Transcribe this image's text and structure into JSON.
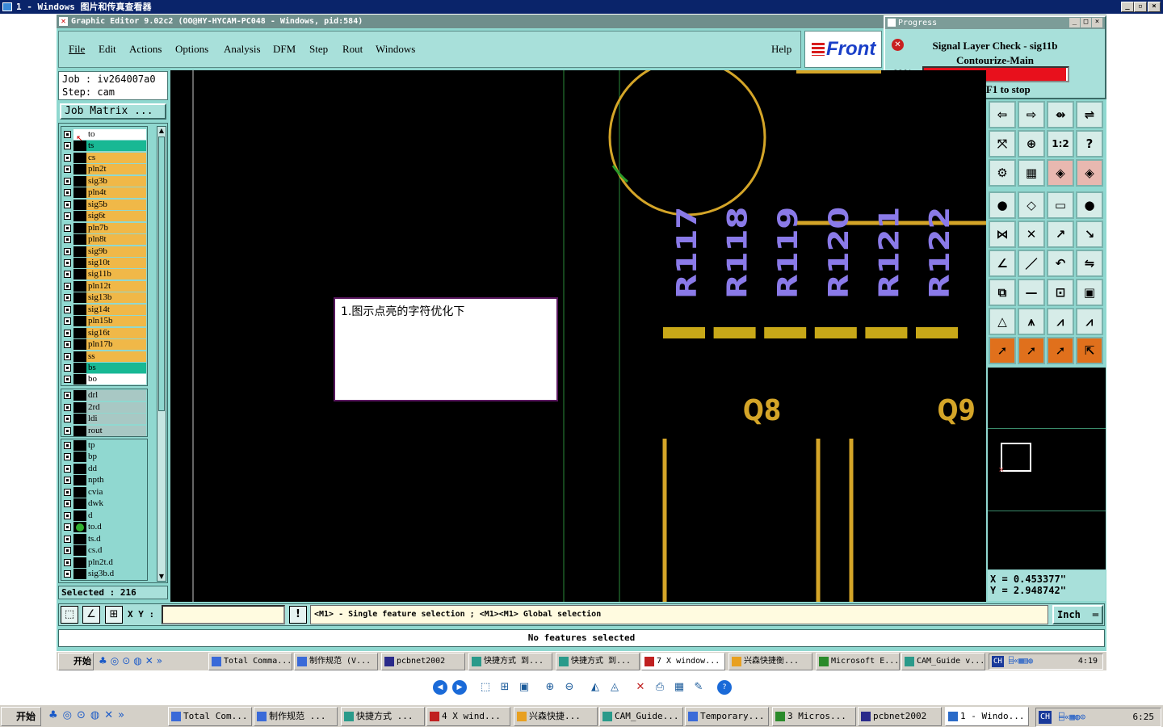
{
  "outer_window": {
    "title": "1 - Windows 图片和传真查看器"
  },
  "editor": {
    "title": "Graphic Editor 9.02c2 (OO@HY-HYCAM-PC048 - Windows, pid:584)",
    "menus": [
      "File",
      "Edit",
      "Actions",
      "Options",
      "Analysis",
      "DFM",
      "Step",
      "Rout",
      "Windows"
    ],
    "help": "Help",
    "logo": "Front"
  },
  "progress": {
    "title": "Progress",
    "line1": "Signal Layer Check - sig11b",
    "line2": "Contourize-Main",
    "percent_label": "99%",
    "percent": 0.99,
    "stop_hint": "Press F1 to stop",
    "bar_color": "#e8101c"
  },
  "job": {
    "job_line": "Job : iv264007a0",
    "step_line": "Step: cam",
    "matrix_button": "Job Matrix ..."
  },
  "layers": [
    {
      "name": "to",
      "color": "#ffffff",
      "mark": "▪"
    },
    {
      "name": "ts",
      "color": "#18b894",
      "mark": ""
    },
    {
      "name": "cs",
      "color": "#f0b848",
      "mark": "◢"
    },
    {
      "name": "pln2t",
      "color": "#f0b848",
      "mark": ""
    },
    {
      "name": "sig3b",
      "color": "#f0b848",
      "mark": ""
    },
    {
      "name": "pln4t",
      "color": "#f0b848",
      "mark": ""
    },
    {
      "name": "sig5b",
      "color": "#f0b848",
      "mark": ""
    },
    {
      "name": "sig6t",
      "color": "#f0b848",
      "mark": ""
    },
    {
      "name": "pln7b",
      "color": "#f0b848",
      "mark": ""
    },
    {
      "name": "pln8t",
      "color": "#f0b848",
      "mark": ""
    },
    {
      "name": "sig9b",
      "color": "#f0b848",
      "mark": ""
    },
    {
      "name": "sig10t",
      "color": "#f0b848",
      "mark": ""
    },
    {
      "name": "sig11b",
      "color": "#f0b848",
      "mark": ""
    },
    {
      "name": "pln12t",
      "color": "#f0b848",
      "mark": ""
    },
    {
      "name": "sig13b",
      "color": "#f0b848",
      "mark": ""
    },
    {
      "name": "sig14t",
      "color": "#f0b848",
      "mark": ""
    },
    {
      "name": "pln15b",
      "color": "#f0b848",
      "mark": ""
    },
    {
      "name": "sig16t",
      "color": "#f0b848",
      "mark": ""
    },
    {
      "name": "pln17b",
      "color": "#f0b848",
      "mark": ""
    },
    {
      "name": "ss",
      "color": "#f0b848",
      "mark": "◢"
    },
    {
      "name": "bs",
      "color": "#18b894",
      "mark": ""
    },
    {
      "name": "bo",
      "color": "#ffffff",
      "mark": ""
    }
  ],
  "layers_drill": [
    {
      "name": "drl",
      "color": "#a8c8c4"
    },
    {
      "name": "2rd",
      "color": "#a8c8c4"
    },
    {
      "name": "ldi",
      "color": "#a8c8c4"
    },
    {
      "name": "rout",
      "color": "#a8c8c4"
    }
  ],
  "layers_misc": [
    {
      "name": "tp",
      "color": "#90d8d0",
      "mark": ""
    },
    {
      "name": "bp",
      "color": "#90d8d0",
      "mark": ""
    },
    {
      "name": "dd",
      "color": "#90d8d0",
      "mark": ""
    },
    {
      "name": "npth",
      "color": "#90d8d0",
      "mark": ""
    },
    {
      "name": "cvia",
      "color": "#90d8d0",
      "mark": ""
    },
    {
      "name": "dwk",
      "color": "#90d8d0",
      "mark": ""
    },
    {
      "name": "d",
      "color": "#90d8d0",
      "mark": ""
    },
    {
      "name": "to.d",
      "color": "#90d8d0",
      "mark": ""
    },
    {
      "name": "ts.d",
      "color": "#90d8d0",
      "mark": ""
    },
    {
      "name": "cs.d",
      "color": "#90d8d0",
      "mark": "◢"
    },
    {
      "name": "pln2t.d",
      "color": "#90d8d0",
      "mark": ""
    },
    {
      "name": "sig3b.d",
      "color": "#90d8d0",
      "mark": ""
    }
  ],
  "selected": "Selected : 216",
  "canvas": {
    "refdes": [
      "R117",
      "R118",
      "R119",
      "R120",
      "R121",
      "R122"
    ],
    "q_labels": [
      "Q8",
      "Q9"
    ],
    "annotation": "1.图示点亮的字符优化下"
  },
  "coords": {
    "x": "X = 0.453377\"",
    "y": "Y = 2.948742\""
  },
  "bottom": {
    "xy_label": "X Y :",
    "xy_value": "",
    "hint": "<M1> - Single feature selection ; <M1><M1> Global selection",
    "units": "Inch",
    "status": "No features selected"
  },
  "inner_taskbar": {
    "start": "开始",
    "items": [
      "Total Comma...",
      "制作规范 (V...",
      "pcbnet2002",
      "快捷方式 到...",
      "快捷方式 到...",
      "7 X window...",
      "兴森快捷衡...",
      "Microsoft E...",
      "CAM_Guide v..."
    ],
    "lang": "CH",
    "time": "4:19"
  },
  "viewer_toolbar": {
    "icons": [
      "prev-icon",
      "next-icon",
      "fit-icon",
      "actual-size-icon",
      "slideshow-icon",
      "zoom-in-icon",
      "zoom-out-icon",
      "rotate-cw-icon",
      "rotate-ccw-icon",
      "delete-icon",
      "print-icon",
      "save-icon",
      "edit-icon",
      "help-icon"
    ]
  },
  "outer_taskbar": {
    "start": "开始",
    "items": [
      "Total Com...",
      "制作规范 ...",
      "快捷方式 ...",
      "4 X wind...",
      "兴森快捷...",
      "CAM_Guide...",
      "Temporary...",
      "3 Micros...",
      "pcbnet2002",
      "1 - Windo..."
    ],
    "lang": "CH",
    "time": "6:25"
  }
}
